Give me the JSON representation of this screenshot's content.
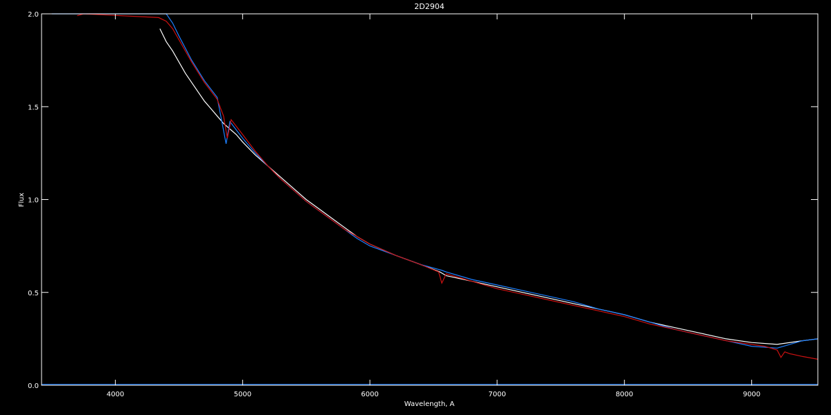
{
  "chart_data": {
    "type": "line",
    "title": "2D2904",
    "xlabel": "Wavelength, A",
    "ylabel": "Flux",
    "xlim": [
      3420,
      9520
    ],
    "ylim": [
      0,
      2.0
    ],
    "x_ticks": [
      4000,
      5000,
      6000,
      7000,
      8000,
      9000
    ],
    "x_tick_labels": [
      "4000",
      "5000",
      "6000",
      "7000",
      "8000",
      "9000"
    ],
    "y_ticks": [
      0.0,
      0.5,
      1.0,
      1.5,
      2.0
    ],
    "y_tick_labels": [
      "0.0",
      "0.5",
      "1.0",
      "1.5",
      "2.0"
    ],
    "grid": false,
    "background": "#000000",
    "series": [
      {
        "color": "#ffffff",
        "x": [
          4350,
          4400,
          4450,
          4500,
          4550,
          4600,
          4650,
          4700,
          4750,
          4800,
          4850,
          4900,
          4950,
          5000,
          5100,
          5200,
          5300,
          5400,
          5500,
          5600,
          5700,
          5800,
          5900,
          6000,
          6200,
          6400,
          6550,
          6600,
          6800,
          7000,
          7200,
          7400,
          7600,
          7800,
          8000,
          8200,
          8400,
          8600,
          8800,
          9000,
          9200,
          9400,
          9520
        ],
        "y": [
          1.92,
          1.85,
          1.8,
          1.74,
          1.68,
          1.63,
          1.58,
          1.53,
          1.49,
          1.45,
          1.41,
          1.38,
          1.35,
          1.31,
          1.24,
          1.18,
          1.12,
          1.06,
          1.0,
          0.95,
          0.9,
          0.85,
          0.8,
          0.76,
          0.7,
          0.65,
          0.61,
          0.59,
          0.56,
          0.53,
          0.5,
          0.47,
          0.44,
          0.41,
          0.38,
          0.34,
          0.31,
          0.28,
          0.25,
          0.23,
          0.22,
          0.24,
          0.25
        ]
      },
      {
        "color": "#1e80ff",
        "x": [
          3500,
          3700,
          3800,
          3900,
          4000,
          4100,
          4200,
          4300,
          4350,
          4400,
          4450,
          4500,
          4600,
          4700,
          4800,
          4870,
          4900,
          5000,
          5100,
          5200,
          5300,
          5400,
          5500,
          5600,
          5700,
          5800,
          5900,
          6000,
          6200,
          6400,
          6560,
          6600,
          6800,
          7000,
          7200,
          7400,
          7600,
          7800,
          8000,
          8200,
          8400,
          8600,
          8800,
          9000,
          9200,
          9300,
          9400,
          9520
        ],
        "y": [
          2.0,
          2.0,
          2.0,
          2.0,
          2.0,
          2.0,
          2.0,
          2.0,
          2.0,
          2.0,
          1.95,
          1.88,
          1.75,
          1.64,
          1.55,
          1.3,
          1.42,
          1.33,
          1.25,
          1.18,
          1.11,
          1.05,
          0.99,
          0.94,
          0.89,
          0.84,
          0.79,
          0.75,
          0.7,
          0.65,
          0.62,
          0.61,
          0.57,
          0.54,
          0.51,
          0.48,
          0.45,
          0.41,
          0.38,
          0.34,
          0.3,
          0.27,
          0.24,
          0.21,
          0.2,
          0.22,
          0.24,
          0.25
        ]
      },
      {
        "color": "#cc1111",
        "x": [
          3700,
          3750,
          4340,
          4400,
          4450,
          4500,
          4600,
          4700,
          4800,
          4850,
          4880,
          4910,
          5000,
          5100,
          5200,
          5300,
          5400,
          5500,
          5600,
          5700,
          5800,
          5900,
          6000,
          6200,
          6400,
          6540,
          6565,
          6600,
          6800,
          7000,
          7200,
          7400,
          7600,
          7800,
          8000,
          8200,
          8400,
          8600,
          8800,
          9000,
          9100,
          9200,
          9230,
          9260,
          9300,
          9400,
          9520
        ],
        "y": [
          1.99,
          2.0,
          1.98,
          1.96,
          1.92,
          1.86,
          1.74,
          1.63,
          1.54,
          1.45,
          1.33,
          1.43,
          1.35,
          1.26,
          1.18,
          1.11,
          1.05,
          0.99,
          0.94,
          0.89,
          0.84,
          0.8,
          0.76,
          0.7,
          0.65,
          0.61,
          0.55,
          0.6,
          0.56,
          0.52,
          0.49,
          0.46,
          0.43,
          0.4,
          0.37,
          0.33,
          0.3,
          0.27,
          0.24,
          0.22,
          0.21,
          0.19,
          0.15,
          0.18,
          0.17,
          0.155,
          0.14
        ]
      },
      {
        "color": "#1e80ff",
        "x": [
          3420,
          9520
        ],
        "y": [
          0.005,
          0.005
        ]
      }
    ]
  }
}
